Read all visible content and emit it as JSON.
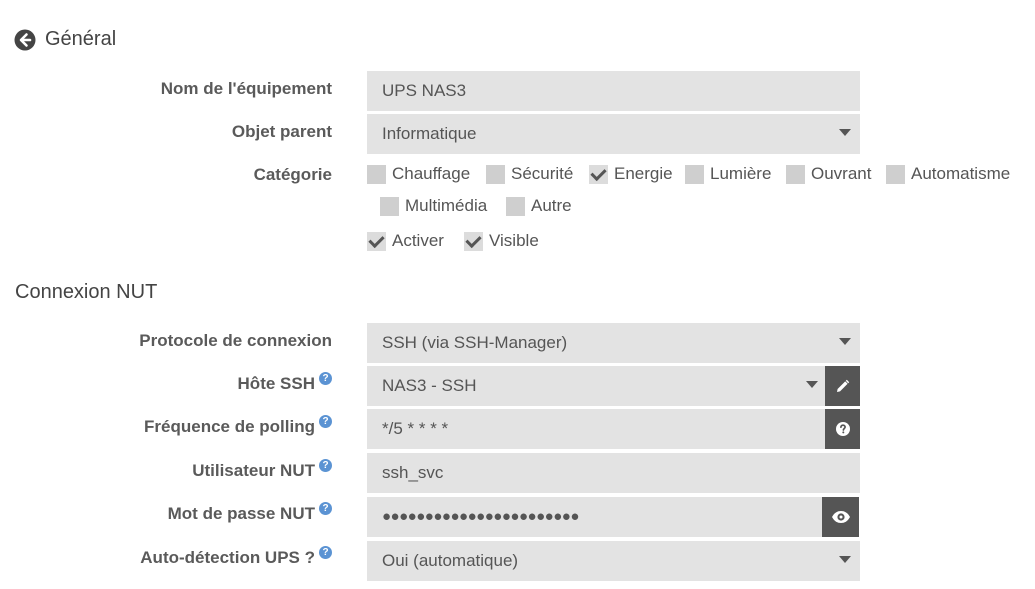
{
  "general": {
    "title": "Général",
    "name_label": "Nom de l'équipement",
    "name_value": "UPS NAS3",
    "parent_label": "Objet parent",
    "parent_value": "Informatique",
    "category_label": "Catégorie",
    "categories": [
      {
        "label": "Chauffage",
        "checked": false
      },
      {
        "label": "Sécurité",
        "checked": false
      },
      {
        "label": "Energie",
        "checked": true
      },
      {
        "label": "Lumière",
        "checked": false
      },
      {
        "label": "Ouvrant",
        "checked": false
      },
      {
        "label": "Automatisme",
        "checked": false
      },
      {
        "label": "Multimédia",
        "checked": false
      },
      {
        "label": "Autre",
        "checked": false
      }
    ],
    "activate_label": "Activer",
    "visible_label": "Visible"
  },
  "nut": {
    "title": "Connexion NUT",
    "protocol_label": "Protocole de connexion",
    "protocol_value": "SSH (via SSH-Manager)",
    "ssh_host_label": "Hôte SSH",
    "ssh_host_value": "NAS3 - SSH",
    "polling_label": "Fréquence de polling",
    "polling_value": "*/5 * * * *",
    "user_label": "Utilisateur NUT",
    "user_value": "ssh_svc",
    "password_label": "Mot de passe NUT",
    "password_value": "●●●●●●●●●●●●●●●●●●●●●●●",
    "autodetect_label": "Auto-détection UPS ?",
    "autodetect_value": "Oui (automatique)",
    "help_glyph": "?"
  },
  "icons": {
    "back": "arrow-left-circle-icon",
    "edit": "pencil-icon",
    "help": "question-circle-icon",
    "reveal": "eye-icon"
  },
  "colors": {
    "field_bg": "#e3e3e3",
    "addon_bg": "#555555",
    "help_blue": "#5b93d3"
  }
}
